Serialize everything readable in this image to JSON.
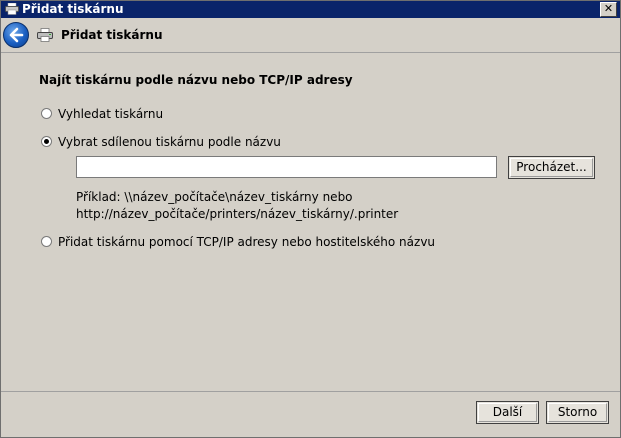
{
  "titlebar": {
    "title": "Přidat tiskárnu",
    "close_label": "✕"
  },
  "navbar": {
    "title": "Přidat tiskárnu"
  },
  "main": {
    "heading": "Najít tiskárnu podle názvu nebo TCP/IP adresy",
    "options": [
      {
        "label": "Vyhledat tiskárnu",
        "selected": false
      },
      {
        "label": "Vybrat sdílenou tiskárnu podle názvu",
        "selected": true
      },
      {
        "label": "Přidat tiskárnu pomocí TCP/IP adresy nebo hostitelského názvu",
        "selected": false
      }
    ],
    "name_input": {
      "value": ""
    },
    "browse_label": "Procházet...",
    "example_line1": "Příklad: \\\\název_počítače\\název_tiskárny nebo",
    "example_line2": "http://název_počítače/printers/název_tiskárny/.printer"
  },
  "footer": {
    "next_label": "Další",
    "cancel_label": "Storno"
  }
}
